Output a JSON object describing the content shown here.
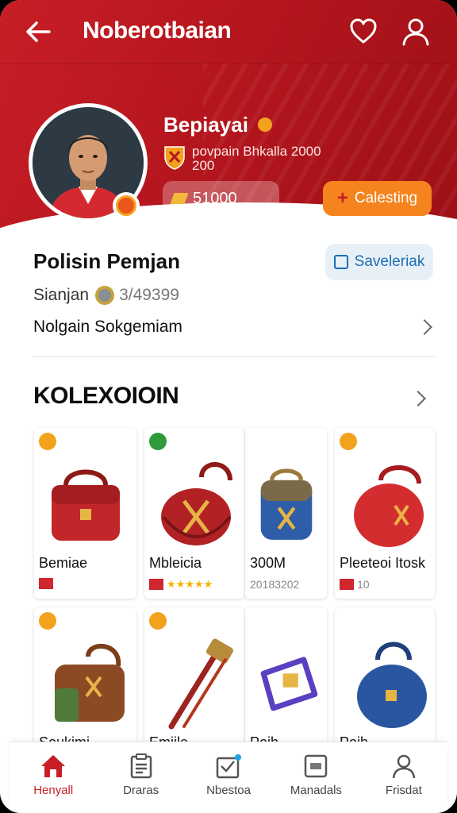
{
  "header": {
    "title": "Noberotbaian"
  },
  "profile": {
    "name": "Bepiayai",
    "club_text": "povpain Bhkalla 2000 200",
    "coins": "51000",
    "action_label": "Calesting",
    "avatar_desc": "player-photo"
  },
  "info": {
    "title": "Polisin Pemjan",
    "chip_label": "Saveleriak",
    "sub_label": "Sianjan",
    "sub_value": "3/49399",
    "link_label": "Nolgain Sokgemiam"
  },
  "collection": {
    "title": "KOLEXOIOIN",
    "items": [
      {
        "name": "Bemiae",
        "meta": "",
        "tag_color": "#f2a21c"
      },
      {
        "name": "Mbleicia",
        "meta": "★★★★★",
        "tag_color": "#2e9a3a"
      },
      {
        "name": "300M",
        "meta": "20183202",
        "tag_color": ""
      },
      {
        "name": "Pleeteoi Itosk",
        "meta": "10",
        "tag_color": "#f2a21c"
      },
      {
        "name": "Soukimi",
        "meta": "",
        "tag_color": "#f2a21c"
      },
      {
        "name": "Emiile",
        "meta": "",
        "tag_color": "#f2a21c"
      },
      {
        "name": "Poih",
        "meta": "",
        "tag_color": ""
      },
      {
        "name": "Poih",
        "meta": "",
        "tag_color": ""
      }
    ]
  },
  "nav": {
    "items": [
      {
        "label": "Henyall",
        "icon": "home-icon"
      },
      {
        "label": "Draras",
        "icon": "clipboard-icon"
      },
      {
        "label": "Nbestoa",
        "icon": "inbox-icon"
      },
      {
        "label": "Manadals",
        "icon": "tablet-icon"
      },
      {
        "label": "Frisdat",
        "icon": "user-icon"
      }
    ]
  },
  "colors": {
    "brand_red": "#c81e26",
    "accent_orange": "#f5841f",
    "chip_blue": "#1b6eb5"
  }
}
